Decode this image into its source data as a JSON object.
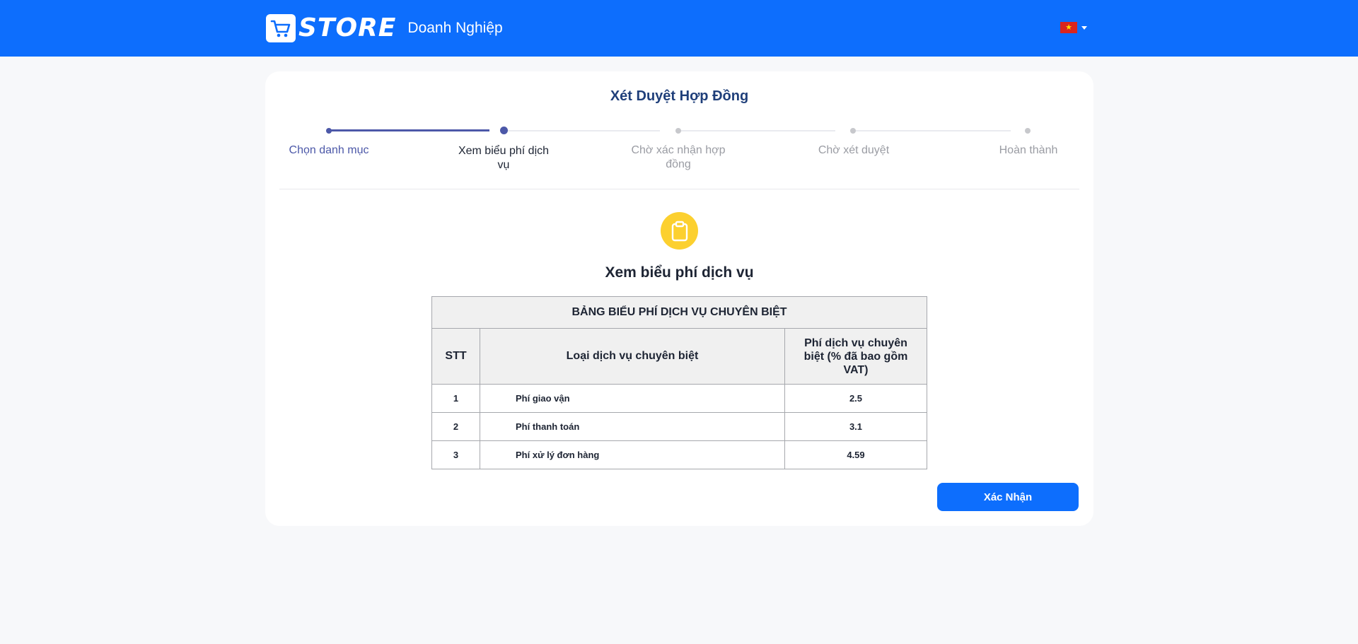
{
  "header": {
    "logo_text": "STORE",
    "subtitle": "Doanh Nghiệp",
    "language_flag": "🇻🇳",
    "brand_color": "#0d6efd"
  },
  "page": {
    "title": "Xét Duyệt Hợp Đồng"
  },
  "stepper": {
    "steps": [
      {
        "label": "Chọn danh mục",
        "state": "done"
      },
      {
        "label": "Xem biểu phí dịch vụ",
        "state": "current"
      },
      {
        "label": "Chờ xác nhận hợp đồng",
        "state": "pending"
      },
      {
        "label": "Chờ xét duyệt",
        "state": "pending"
      },
      {
        "label": "Hoàn thành",
        "state": "pending"
      }
    ]
  },
  "section": {
    "icon": "clipboard-icon",
    "title": "Xem biểu phí dịch vụ"
  },
  "fee_table": {
    "caption": "BẢNG BIỂU PHÍ DỊCH VỤ CHUYÊN BIỆT",
    "columns": [
      "STT",
      "Loại dịch vụ chuyên biệt",
      "Phí dịch vụ chuyên biệt (% đã bao gồm VAT)"
    ],
    "rows": [
      {
        "stt": "1",
        "name": "Phí giao vận",
        "fee": "2.5"
      },
      {
        "stt": "2",
        "name": "Phí thanh toán",
        "fee": "3.1"
      },
      {
        "stt": "3",
        "name": "Phí xử lý đơn hàng",
        "fee": "4.59"
      }
    ]
  },
  "actions": {
    "confirm_label": "Xác Nhận"
  }
}
